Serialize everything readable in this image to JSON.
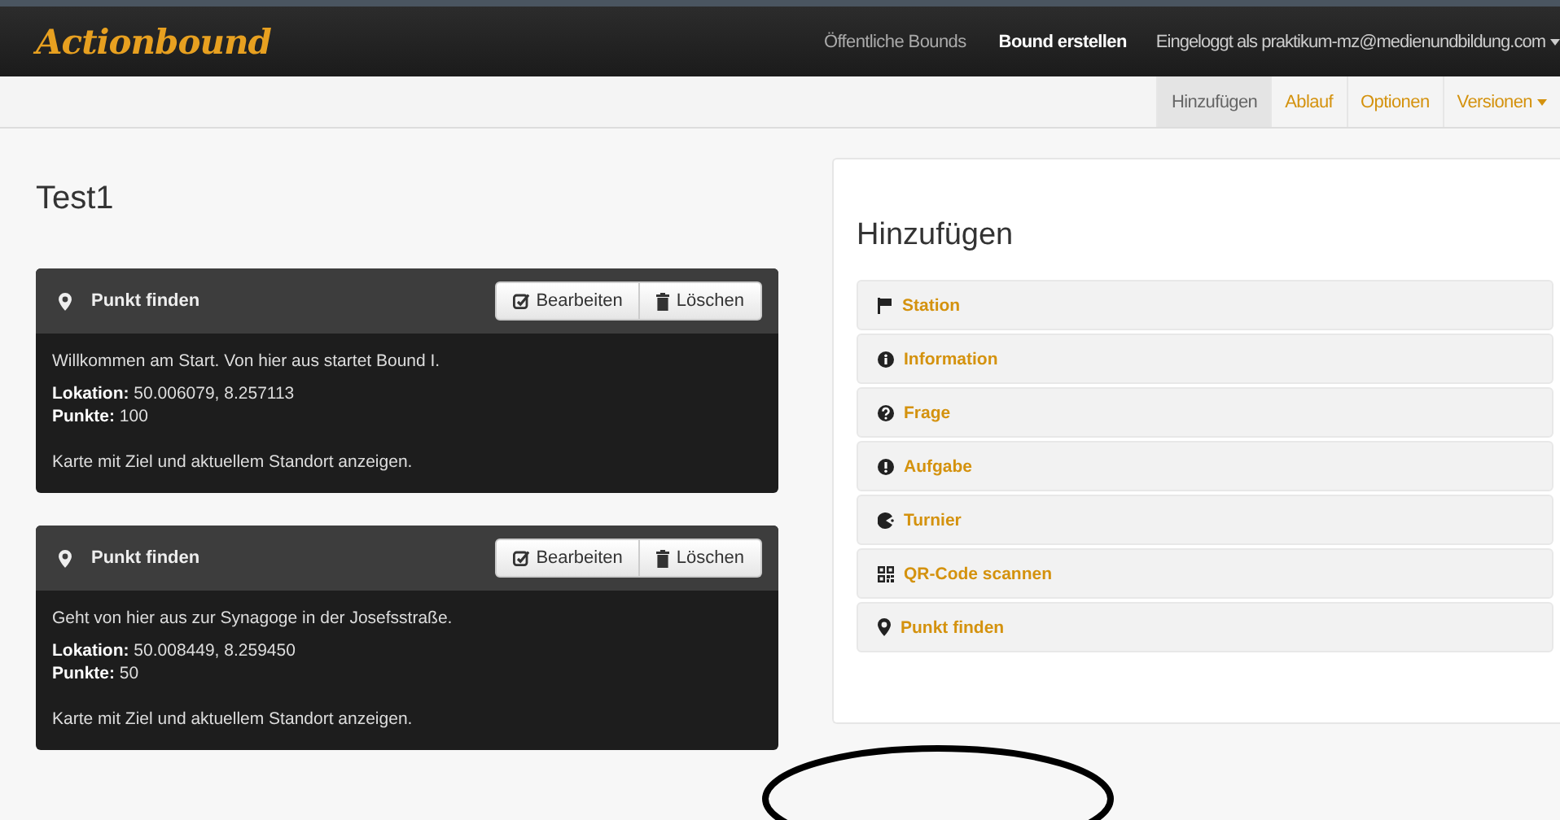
{
  "navbar": {
    "logo": "Actionbound",
    "links": [
      {
        "label": "Öffentliche Bounds",
        "selected": false
      },
      {
        "label": "Bound erstellen",
        "selected": true
      }
    ],
    "user_menu": "Eingeloggt als praktikum-mz@medienundbildung.com"
  },
  "subnav": {
    "tabs": [
      {
        "label": "Hinzufügen",
        "selected": true,
        "dropdown": false
      },
      {
        "label": "Ablauf",
        "selected": false,
        "dropdown": false
      },
      {
        "label": "Optionen",
        "selected": false,
        "dropdown": false
      },
      {
        "label": "Versionen",
        "selected": false,
        "dropdown": true
      }
    ]
  },
  "bound": {
    "title": "Test1",
    "elements": [
      {
        "type": "Punkt finden",
        "description": "Willkommen am Start. Von hier aus startet Bound I.",
        "location": "**Lokation:** 50.006079, 8.257113",
        "points": "**Punkte:** 100",
        "map_link": "Karte mit Ziel und aktuellem Standort anzeigen.",
        "buttons": [
          {
            "label": "Bearbeiten",
            "kind": "edit"
          },
          {
            "label": "Löschen",
            "kind": "delete"
          }
        ]
      },
      {
        "type": "Punkt finden",
        "description": "Geht von hier aus zur Synagoge in der Josefsstraße.",
        "location": "**Lokation:** 50.008449, 8.259450",
        "points": "**Punkte:** 50",
        "map_link": "Karte mit Ziel und aktuellem Standort anzeigen.",
        "buttons": [
          {
            "label": "Bearbeiten",
            "kind": "edit"
          },
          {
            "label": "Löschen",
            "kind": "delete"
          }
        ]
      }
    ]
  },
  "add_panel": {
    "title": "Hinzufügen",
    "items": [
      {
        "label": "Station",
        "kind": "flag"
      },
      {
        "label": "Information",
        "kind": "info"
      },
      {
        "label": "Frage",
        "kind": "question"
      },
      {
        "label": "Aufgabe",
        "kind": "exclamation"
      },
      {
        "label": "Turnier",
        "kind": "tournament"
      },
      {
        "label": "QR-Code scannen",
        "kind": "qrcode"
      },
      {
        "label": "Punkt finden",
        "kind": "pin"
      }
    ]
  }
}
